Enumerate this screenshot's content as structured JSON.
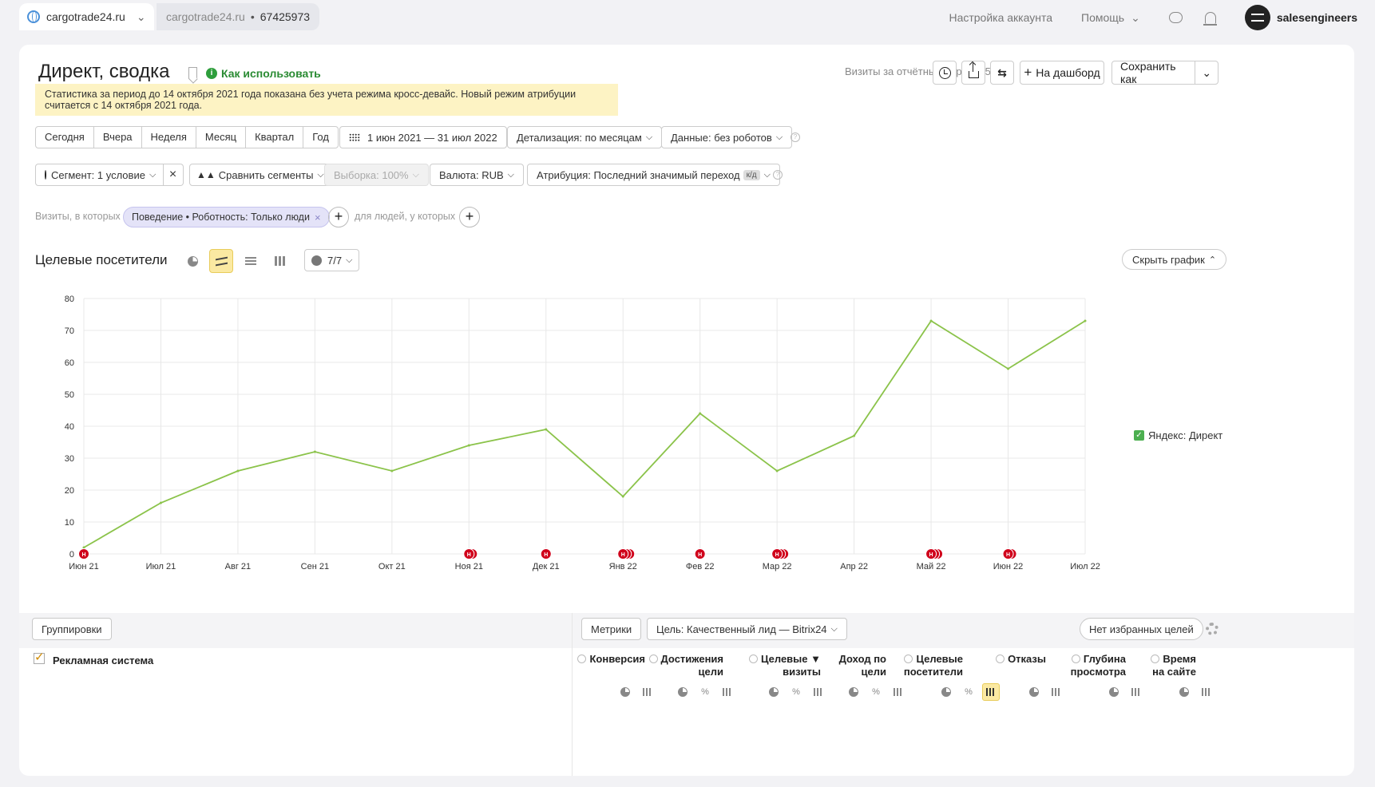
{
  "topbar": {
    "site": "cargotrade24.ru",
    "counter_site": "cargotrade24.ru",
    "counter_id": "67425973",
    "account_settings": "Настройка аккаунта",
    "help": "Помощь",
    "username": "salesengineers"
  },
  "header": {
    "title": "Директ, сводка",
    "howto": "Как использовать",
    "visits_period": "Визиты за отчётный период: 577",
    "to_dashboard": "На дашборд",
    "save_as": "Сохранить как"
  },
  "notice": "Статистика за период до 14 октября 2021 года показана без учета режима кросс-девайс. Новый режим атрибуции считается с 14 октября 2021 года.",
  "periods": [
    "Сегодня",
    "Вчера",
    "Неделя",
    "Месяц",
    "Квартал",
    "Год"
  ],
  "date_range": "1 июн 2021 — 31 июл 2022",
  "detail": "Детализация: по месяцам",
  "data_filter": "Данные: без роботов",
  "segment": "Сегмент: 1 условие",
  "compare": "Сравнить сегменты",
  "sample": "Выборка: 100%",
  "currency": "Валюта: RUB",
  "attribution": "Атрибуция: Последний значимый переход",
  "attribution_badge": "к/д",
  "filters": {
    "visits_label": "Визиты, в которых",
    "chip": "Поведение • Роботность: Только люди",
    "people_label": "для людей, у которых"
  },
  "chart_header": {
    "title": "Целевые посетители",
    "notes": "7/7",
    "hide": "Скрыть график"
  },
  "chart_data": {
    "type": "line",
    "x": [
      "Июн 21",
      "Июл 21",
      "Авг 21",
      "Сен 21",
      "Окт 21",
      "Ноя 21",
      "Дек 21",
      "Янв 22",
      "Фев 22",
      "Мар 22",
      "Апр 22",
      "Май 22",
      "Июн 22",
      "Июл 22"
    ],
    "series": [
      {
        "name": "Яндекс: Директ",
        "values": [
          2,
          16,
          26,
          32,
          26,
          34,
          39,
          18,
          44,
          26,
          37,
          73,
          58,
          73
        ],
        "color": "#8bc34a"
      }
    ],
    "yticks": [
      0,
      10,
      20,
      30,
      40,
      50,
      60,
      70,
      80
    ],
    "ylim": [
      0,
      80
    ],
    "grid": true,
    "legend": "right",
    "markers": {
      "label": "Н",
      "indices": [
        0,
        5,
        6,
        7,
        8,
        9,
        11,
        12
      ],
      "counts": [
        1,
        2,
        1,
        3,
        1,
        3,
        3,
        2
      ],
      "color": "#d0021b"
    }
  },
  "table": {
    "groupings": "Группировки",
    "metrics": "Метрики",
    "goal": "Цель: Качественный лид — Bitrix24",
    "no_favorites": "Нет избранных целей",
    "row_label": "Рекламная система",
    "columns": [
      {
        "l1": "Конверсия",
        "l2": ""
      },
      {
        "l1": "Достижения",
        "l2": "цели"
      },
      {
        "l1": "Целевые ▼",
        "l2": "визиты"
      },
      {
        "l1": "Доход по",
        "l2": "цели"
      },
      {
        "l1": "Целевые",
        "l2": "посетители"
      },
      {
        "l1": "Отказы",
        "l2": ""
      },
      {
        "l1": "Глубина",
        "l2": "просмотра"
      },
      {
        "l1": "Время",
        "l2": "на сайте"
      }
    ]
  }
}
